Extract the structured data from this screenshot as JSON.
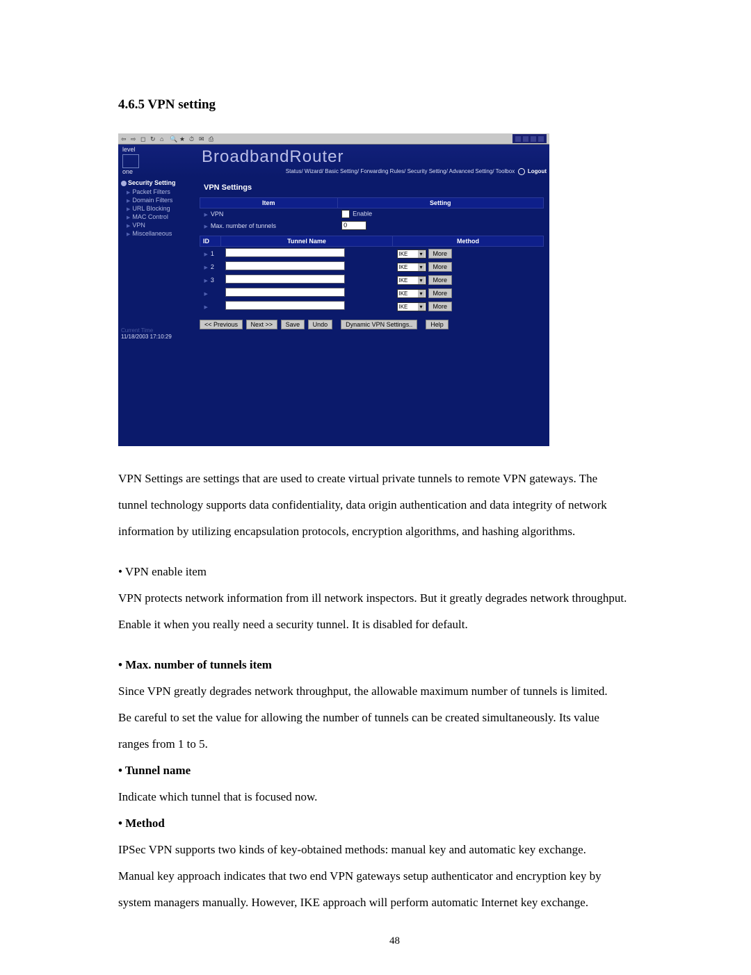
{
  "page": {
    "section_number": "4.6.5",
    "section_title": "VPN setting",
    "page_number": "48"
  },
  "screenshot": {
    "toolbar": {
      "window_controls": "– ◻ ✕"
    },
    "brand": {
      "logo_top": "level",
      "logo_bottom": "one",
      "title": "BroadbandRouter"
    },
    "nav": {
      "status": "Status/",
      "wizard": "Wizard/",
      "basic": "Basic Setting/",
      "forwarding": "Forwarding Rules/",
      "security": "Security Setting/",
      "advanced": "Advanced Setting/",
      "toolbox": "Toolbox",
      "logout": "Logout"
    },
    "sidebar": {
      "category": "Security Setting",
      "items": [
        "Packet Filters",
        "Domain Filters",
        "URL Blocking",
        "MAC Control",
        "VPN",
        "Miscellaneous"
      ],
      "time_label": "Current Time",
      "time_value": "11/18/2003 17:10:29"
    },
    "main": {
      "title": "VPN Settings",
      "items_header": {
        "item": "Item",
        "setting": "Setting"
      },
      "rows": {
        "vpn_label": "VPN",
        "vpn_enable": "Enable",
        "max_label": "Max. number of tunnels",
        "max_value": "0"
      },
      "tunnel_header": {
        "id": "ID",
        "name": "Tunnel Name",
        "method": "Method"
      },
      "tunnels": [
        {
          "id": "1",
          "method": "IKE",
          "more": "More"
        },
        {
          "id": "2",
          "method": "IKE",
          "more": "More"
        },
        {
          "id": "3",
          "method": "IKE",
          "more": "More"
        },
        {
          "id": "",
          "method": "IKE",
          "more": "More"
        },
        {
          "id": "",
          "method": "IKE",
          "more": "More"
        }
      ],
      "buttons": {
        "prev": "<< Previous",
        "next": "Next >>",
        "save": "Save",
        "undo": "Undo",
        "dynamic": "Dynamic VPN Settings..",
        "help": "Help"
      }
    }
  },
  "text": {
    "intro1": "VPN Settings are settings that are used to create virtual private tunnels to remote VPN gateways. The",
    "intro2": "tunnel technology supports data confidentiality, data origin authentication and data integrity of network",
    "intro3": "information by utilizing encapsulation protocols, encryption algorithms, and hashing algorithms.",
    "b1": "• VPN enable item",
    "b1_1": "VPN protects network information from ill network inspectors. But it greatly degrades network throughput.",
    "b1_2": "Enable it when you really need a security tunnel. It is disabled for default.",
    "b2": "• Max. number of tunnels item",
    "b2_1": "Since VPN greatly degrades network throughput, the allowable maximum number of tunnels is limited.",
    "b2_2": "Be careful to set the value for allowing the number of tunnels can be created simultaneously. Its value",
    "b2_3": "ranges from 1 to 5.",
    "b3": "• Tunnel name",
    "b3_1": "Indicate which tunnel that is focused now.",
    "b4": "• Method",
    "b4_1": "IPSec VPN supports two kinds of key-obtained methods: manual key and automatic key exchange.",
    "b4_2": "Manual key approach indicates that two end VPN gateways setup authenticator and encryption key by",
    "b4_3": "system managers manually. However, IKE approach will perform automatic Internet key exchange."
  }
}
